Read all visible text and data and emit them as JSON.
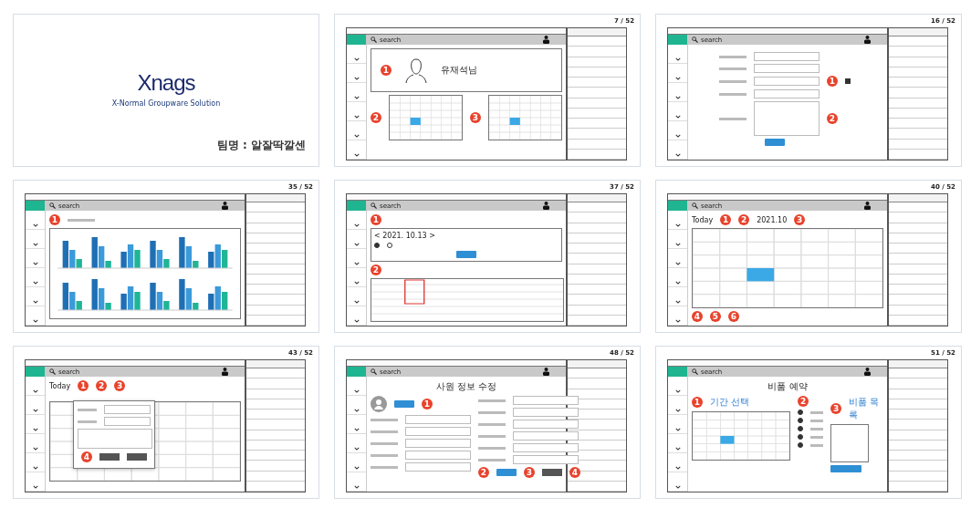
{
  "slides": [
    {
      "kind": "title",
      "logo": "Xnags",
      "subtitle": "X-Normal Groupware Solution",
      "team": "팀명 : 알잘딱깔센"
    },
    {
      "kind": "profile",
      "page": "7 / 52",
      "search": "search",
      "name": "유재석님",
      "badges": [
        "1",
        "2",
        "3"
      ]
    },
    {
      "kind": "form",
      "page": "16 / 52",
      "search": "search",
      "checked": true,
      "badges": [
        "1",
        "2"
      ]
    },
    {
      "kind": "chart",
      "page": "35 / 52",
      "search": "search",
      "badges": [
        "1"
      ]
    },
    {
      "kind": "table",
      "page": "37 / 52",
      "search": "search",
      "date": "< 2021. 10.13 >",
      "options": [
        {
          "selected": true
        },
        {
          "selected": false
        }
      ],
      "badges": [
        "1",
        "2"
      ]
    },
    {
      "kind": "calendar",
      "page": "40 / 52",
      "search": "search",
      "today": "Today",
      "month": "2021.10",
      "badges": [
        "1",
        "2",
        "3",
        "4",
        "5",
        "6"
      ]
    },
    {
      "kind": "modal",
      "page": "43 / 52",
      "search": "search",
      "today": "Today",
      "badges": [
        "1",
        "2",
        "3",
        "4"
      ]
    },
    {
      "kind": "editform",
      "page": "48 / 52",
      "search": "search",
      "title": "사원 정보 수정",
      "badges": [
        "1",
        "2",
        "3",
        "4"
      ]
    },
    {
      "kind": "booking",
      "page": "51 / 52",
      "search": "search",
      "title": "비품 예약",
      "period": "기간 선택",
      "list": "비품 목록",
      "options": [
        {
          "selected": true
        },
        {
          "selected": true
        },
        {
          "selected": true
        },
        {
          "selected": true
        },
        {
          "selected": true
        }
      ],
      "badges": [
        "1",
        "2",
        "3"
      ]
    }
  ]
}
